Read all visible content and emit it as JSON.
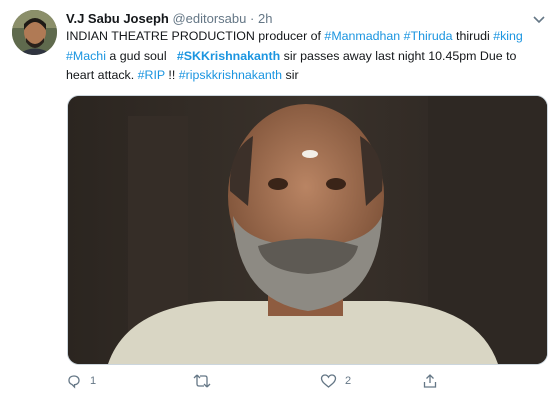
{
  "tweet": {
    "author_name": "V.J Sabu Joseph",
    "handle": "@editorsabu",
    "separator": "·",
    "time": "2h",
    "text_runs": [
      {
        "text": "INDIAN THEATRE PRODUCTION producer of ",
        "type": "plain"
      },
      {
        "text": "#Manmadhan",
        "type": "tag"
      },
      {
        "text": " ",
        "type": "plain"
      },
      {
        "text": "#Thiruda",
        "type": "tag"
      },
      {
        "text": " thirudi ",
        "type": "plain"
      },
      {
        "text": "#king",
        "type": "tag"
      },
      {
        "text": " ",
        "type": "plain"
      },
      {
        "text": "#Machi",
        "type": "tag"
      },
      {
        "text": " a gud soul   ",
        "type": "plain"
      },
      {
        "text": "#SKKrishnakanth",
        "type": "tag-bold"
      },
      {
        "text": " sir passes away last night 10.45pm Due to heart attack. ",
        "type": "plain"
      },
      {
        "text": "#RIP",
        "type": "tag"
      },
      {
        "text": " !! ",
        "type": "plain"
      },
      {
        "text": "#ripskkrishnakanth",
        "type": "tag"
      },
      {
        "text": " sir",
        "type": "plain"
      }
    ]
  },
  "actions": {
    "reply_count": "1",
    "retweet_count": "",
    "like_count": "2"
  },
  "icons": [
    "avatar",
    "chevron-down-icon",
    "reply-icon",
    "retweet-icon",
    "like-icon",
    "share-icon"
  ],
  "colors": {
    "link": "#1b95e0",
    "muted": "#657786",
    "text": "#14171a"
  }
}
